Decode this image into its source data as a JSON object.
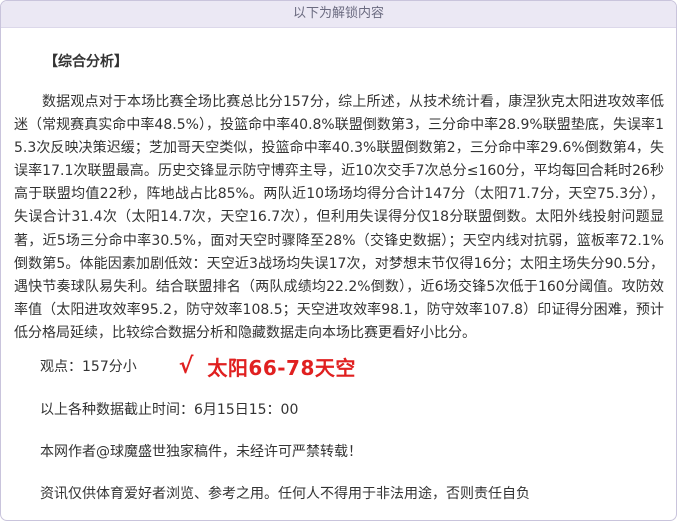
{
  "banner": {
    "text": "以下为解锁内容"
  },
  "article": {
    "section_title": "【综合分析】",
    "body": "数据观点对于本场比赛全场比赛总比分157分，综上所述，从技术统计看，康涅狄克太阳进攻效率低迷（常规赛真实命中率48.5%），投篮命中率40.8%联盟倒数第3，三分命中率28.9%联盟垫底，失误率15.3次反映决策迟缓；芝加哥天空类似，投篮命中率40.3%联盟倒数第2，三分命中率29.6%倒数第4，失误率17.1次联盟最高。历史交锋显示防守博弈主导，近10次交手7次总分≤160分，平均每回合耗时26秒高于联盟均值22秒，阵地战占比85%。两队近10场场均得分合计147分（太阳71.7分，天空75.3分），失误合计31.4次（太阳14.7次，天空16.7次），但利用失误得分仅18分联盟倒数。太阳外线投射问题显著，近5场三分命中率30.5%，面对天空时骤降至28%（交锋史数据）；天空内线对抗弱，篮板率72.1%倒数第5。体能因素加剧低效：天空近3战场均失误17次，对梦想末节仅得16分；太阳主场失分90.5分，遇快节奏球队易失利。结合联盟排名（两队成绩均22.2%倒数），近6场交锋5次低于160分阈值。攻防效率值（太阳进攻效率95.2，防守效率108.5；天空进攻效率98.1，防守效率107.8）印证得分困难，预计低分格局延续，比较综合数据分析和隐藏数据走向本场比赛更看好小比分。",
    "pick_label": "观点：157分小",
    "pick_check": "√",
    "pick_result": "太阳66-78天空",
    "data_cutoff": "以上各种数据截止时间：6月15日15：00",
    "author_note": "本网作者@球魔盛世独家稿件，未经许可严禁转载！",
    "disclaimer": "资讯仅供体育爱好者浏览、参考之用。任何人不得用于非法用途，否则责任自负"
  }
}
